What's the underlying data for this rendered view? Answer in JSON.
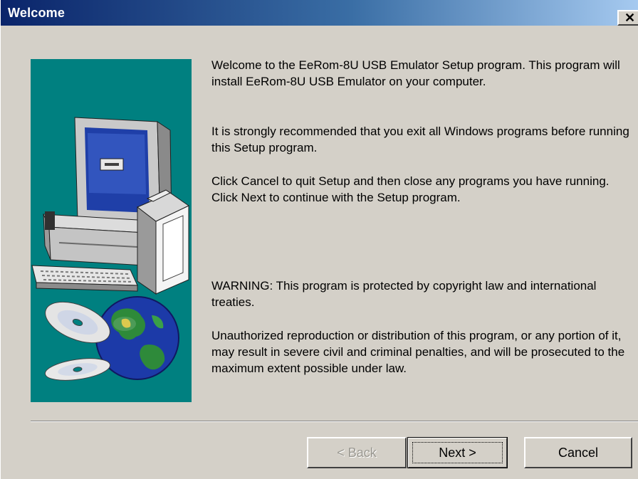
{
  "window": {
    "title": "Welcome",
    "close_glyph": "✕"
  },
  "illustration": {
    "icons": [
      "monitor-icon",
      "computer-tower-icon",
      "keyboard-icon",
      "software-box-icon",
      "cd-disc-icon",
      "globe-icon"
    ],
    "background_color": "#008080"
  },
  "content": {
    "paragraph_1": "Welcome to the EeRom-8U USB Emulator Setup program.  This program will install EeRom-8U USB Emulator on your computer.",
    "paragraph_2": "It is strongly recommended that you exit all Windows programs before running this Setup program.",
    "paragraph_3": "Click Cancel to quit Setup and then close any programs you have running.  Click Next to continue with the Setup program.",
    "paragraph_4": "WARNING: This program is protected by copyright law and international treaties.",
    "paragraph_5": "Unauthorized reproduction or distribution of this program, or any portion of it, may result in severe civil and criminal penalties, and will be prosecuted to the maximum extent possible under law."
  },
  "buttons": {
    "back_label": "< Back",
    "next_label": "Next >",
    "cancel_label": "Cancel",
    "back_enabled": false
  },
  "colors": {
    "title_gradient_start": "#0a246a",
    "title_gradient_end": "#a6caf0",
    "dialog_face": "#d4d0c8"
  }
}
